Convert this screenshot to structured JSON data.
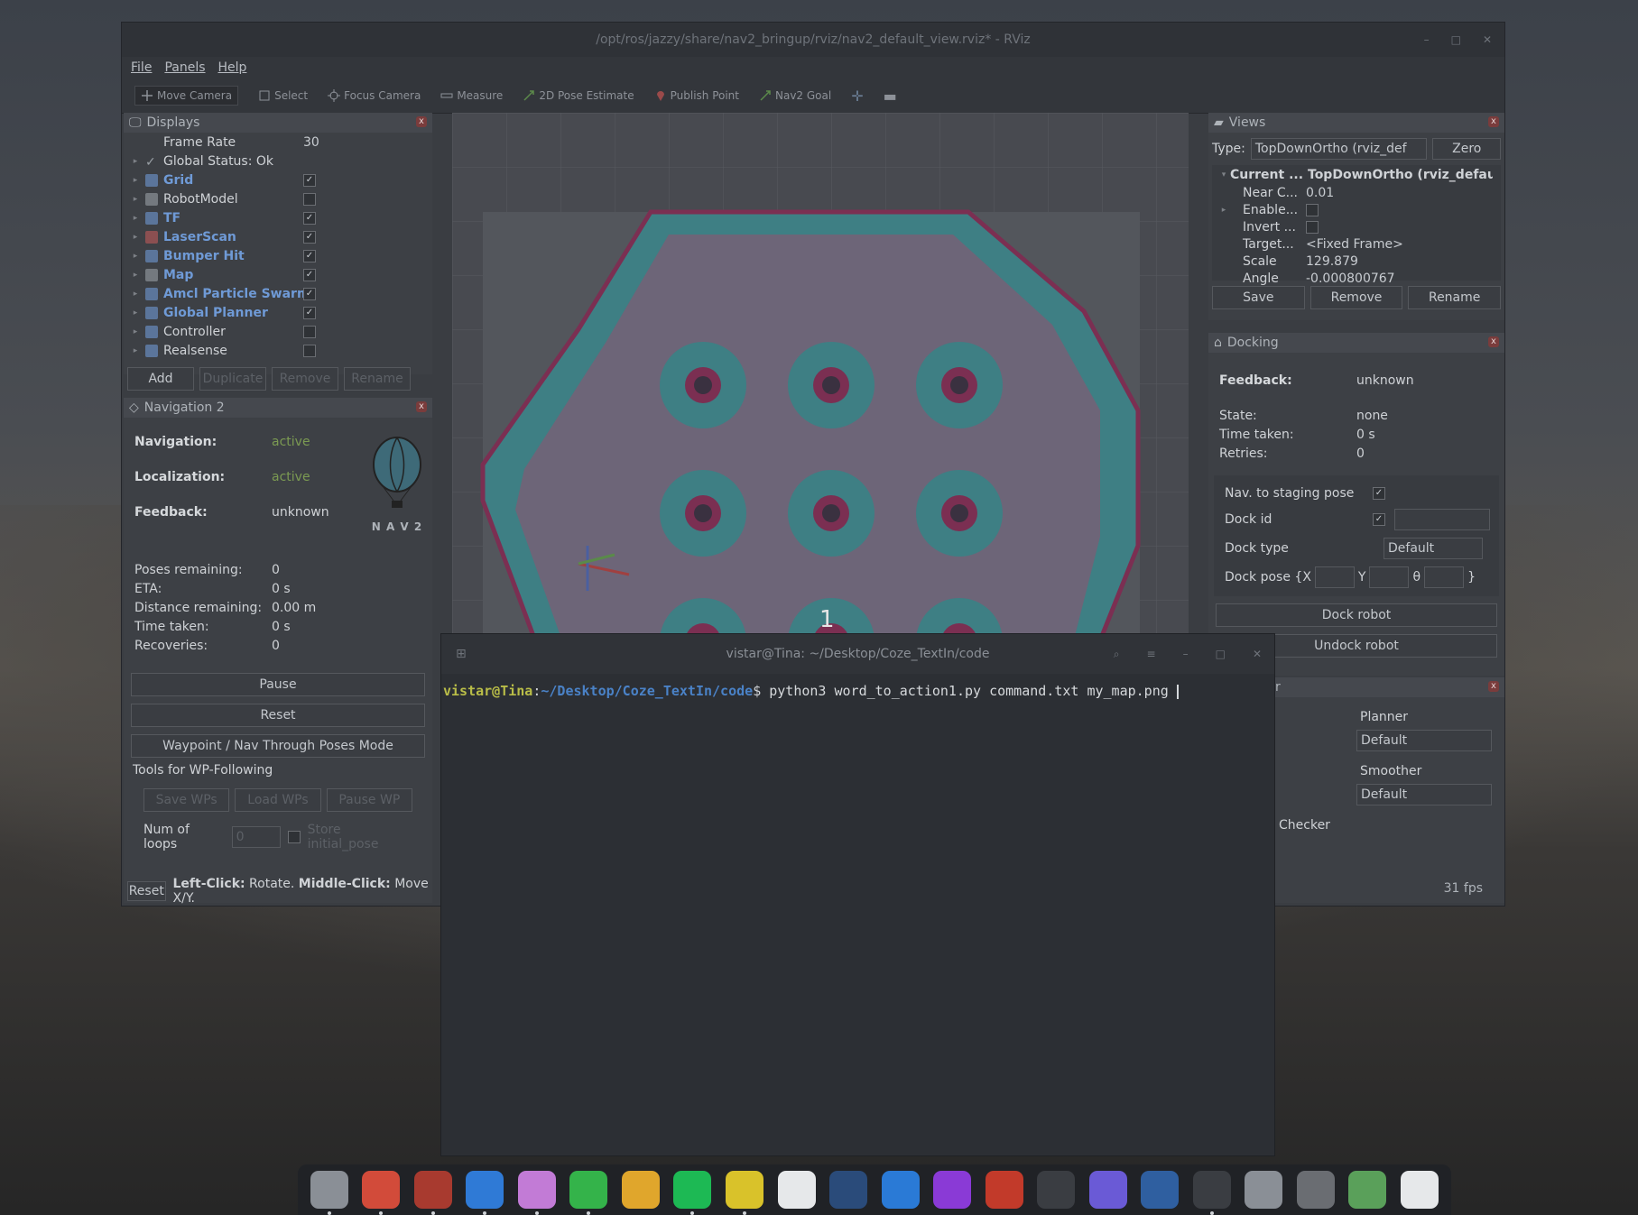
{
  "rviz": {
    "title": "/opt/ros/jazzy/share/nav2_bringup/rviz/nav2_default_view.rviz* - RViz",
    "menu": [
      "File",
      "Panels",
      "Help"
    ],
    "toolbar": [
      "Move Camera",
      "Select",
      "Focus Camera",
      "Measure",
      "2D Pose Estimate",
      "Publish Point",
      "Nav2 Goal"
    ],
    "displays": {
      "title": "Displays",
      "frame_rate_label": "Frame Rate",
      "frame_rate_value": "30",
      "global_status": "Global Status: Ok",
      "items": [
        {
          "label": "Grid",
          "checked": true,
          "blue": true
        },
        {
          "label": "RobotModel",
          "checked": false,
          "blue": false
        },
        {
          "label": "TF",
          "checked": true,
          "blue": true
        },
        {
          "label": "LaserScan",
          "checked": true,
          "blue": true
        },
        {
          "label": "Bumper Hit",
          "checked": true,
          "blue": true
        },
        {
          "label": "Map",
          "checked": true,
          "blue": true
        },
        {
          "label": "Amcl Particle Swarm",
          "checked": true,
          "blue": true
        },
        {
          "label": "Global Planner",
          "checked": true,
          "blue": true
        },
        {
          "label": "Controller",
          "checked": false,
          "blue": false
        },
        {
          "label": "Realsense",
          "checked": false,
          "blue": false
        }
      ],
      "buttons": [
        "Add",
        "Duplicate",
        "Remove",
        "Rename"
      ]
    },
    "nav2": {
      "title": "Navigation 2",
      "navigation_label": "Navigation:",
      "navigation_value": "active",
      "localization_label": "Localization:",
      "localization_value": "active",
      "feedback_label": "Feedback:",
      "feedback_value": "unknown",
      "logo_text": "N A V 2",
      "stats": [
        {
          "k": "Poses remaining:",
          "v": "0"
        },
        {
          "k": "ETA:",
          "v": "0 s"
        },
        {
          "k": "Distance remaining:",
          "v": "0.00 m"
        },
        {
          "k": "Time taken:",
          "v": "0 s"
        },
        {
          "k": "Recoveries:",
          "v": "0"
        }
      ],
      "pause": "Pause",
      "reset": "Reset",
      "waypoint_mode": "Waypoint / Nav Through Poses Mode",
      "tools_label": "Tools for WP-Following",
      "wp_buttons": [
        "Save WPs",
        "Load WPs",
        "Pause WP"
      ],
      "loops_label": "Num of loops",
      "loops_value": "0",
      "store_initial": "Store initial_pose"
    },
    "status": {
      "reset": "Reset",
      "hint_bold1": "Left-Click:",
      "hint1": " Rotate. ",
      "hint_bold2": "Middle-Click:",
      "hint2": " Move X/Y.",
      "fps": "31 fps"
    },
    "views": {
      "title": "Views",
      "type_label": "Type:",
      "type_value": "TopDownOrtho (rviz_def",
      "zero": "Zero",
      "current_label": "Current ...",
      "current_value": "TopDownOrtho (rviz_defaul...",
      "props": [
        {
          "k": "Near C...",
          "v": "0.01"
        },
        {
          "k": "Enable...",
          "v": ""
        },
        {
          "k": "Invert ...",
          "v": ""
        },
        {
          "k": "Target...",
          "v": "<Fixed Frame>"
        },
        {
          "k": "Scale",
          "v": "129.879"
        },
        {
          "k": "Angle",
          "v": "-0.000800767"
        }
      ],
      "buttons": [
        "Save",
        "Remove",
        "Rename"
      ]
    },
    "docking": {
      "title": "Docking",
      "feedback_label": "Feedback:",
      "feedback_value": "unknown",
      "state_label": "State:",
      "state_value": "none",
      "time_label": "Time taken:",
      "time_value": "0 s",
      "retries_label": "Retries:",
      "retries_value": "0",
      "staging_label": "Nav. to staging pose",
      "dock_id_label": "Dock id",
      "dock_type_label": "Dock type",
      "dock_type_value": "Default",
      "dock_pose_label": "Dock pose {X",
      "y_label": "Y",
      "theta_label": "θ",
      "close_brace": "}",
      "dock_btn": "Dock robot",
      "undock_btn": "Undock robot"
    },
    "planner": {
      "title_fragment": "r",
      "col1_frag": "r",
      "planner_label": "Planner",
      "planner_value": "Default",
      "checker_frag": "cker",
      "smoother_label": "Smoother",
      "smoother_value": "Default",
      "goal_checker_frag": "Checker"
    },
    "viewport_label": "1"
  },
  "terminal": {
    "title": "vistar@Tina: ~/Desktop/Coze_TextIn/code",
    "user": "vistar@Tina",
    "path": "~/Desktop/Coze_TextIn/code",
    "prompt_sym": "$",
    "command": " python3 word_to_action1.py command.txt my_map.png "
  },
  "dock_apps": [
    "files",
    "chrome",
    "app-grid-red",
    "vscode",
    "cat-app",
    "wechat",
    "qq-penguin",
    "spotify",
    "music-note",
    "video-player",
    "steam",
    "feishu",
    "flame-app",
    "ladybug",
    "obs",
    "chat-app",
    "pen-tool",
    "terminal",
    "settings",
    "software-updater",
    "recycle-bin",
    "ubuntu"
  ]
}
